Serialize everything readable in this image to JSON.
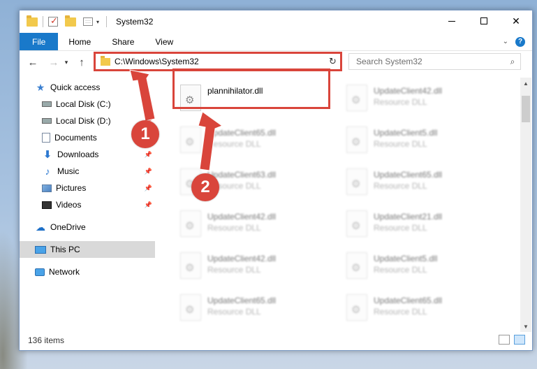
{
  "window": {
    "title": "System32"
  },
  "ribbon": {
    "tabs": [
      "File",
      "Home",
      "Share",
      "View"
    ]
  },
  "navbar": {
    "address": "C:\\Windows\\System32",
    "search_placeholder": "Search System32"
  },
  "sidebar": {
    "items": [
      {
        "label": "Quick access",
        "icon": "star-icon",
        "pinned": false
      },
      {
        "label": "Local Disk (C:)",
        "icon": "disk-icon",
        "pinned": true
      },
      {
        "label": "Local Disk (D:)",
        "icon": "disk-icon",
        "pinned": true
      },
      {
        "label": "Documents",
        "icon": "documents-icon",
        "pinned": true
      },
      {
        "label": "Downloads",
        "icon": "downloads-icon",
        "pinned": true
      },
      {
        "label": "Music",
        "icon": "music-icon",
        "pinned": true
      },
      {
        "label": "Pictures",
        "icon": "pictures-icon",
        "pinned": true
      },
      {
        "label": "Videos",
        "icon": "videos-icon",
        "pinned": true
      },
      {
        "label": "OneDrive",
        "icon": "cloud-icon",
        "pinned": false
      },
      {
        "label": "This PC",
        "icon": "computer-icon",
        "pinned": false,
        "selected": true
      },
      {
        "label": "Network",
        "icon": "network-icon",
        "pinned": false
      }
    ]
  },
  "files": [
    {
      "name": "plannihilator.dll",
      "desc": "",
      "highlight": true
    },
    {
      "name": "UpdateClient42.dll",
      "desc": "Resource DLL"
    },
    {
      "name": "UpdateClient65.dll",
      "desc": "Resource DLL"
    },
    {
      "name": "UpdateClient5.dll",
      "desc": "Resource DLL"
    },
    {
      "name": "UpdateClient63.dll",
      "desc": "Resource DLL"
    },
    {
      "name": "UpdateClient65.dll",
      "desc": "Resource DLL"
    },
    {
      "name": "UpdateClient42.dll",
      "desc": "Resource DLL"
    },
    {
      "name": "UpdateClient21.dll",
      "desc": "Resource DLL"
    },
    {
      "name": "UpdateClient42.dll",
      "desc": "Resource DLL"
    },
    {
      "name": "UpdateClient5.dll",
      "desc": "Resource DLL"
    },
    {
      "name": "UpdateClient65.dll",
      "desc": "Resource DLL"
    },
    {
      "name": "UpdateClient65.dll",
      "desc": "Resource DLL"
    }
  ],
  "status": {
    "items_count": "136 items"
  },
  "annotations": {
    "step1": "1",
    "step2": "2",
    "color": "#d9453b"
  },
  "colors": {
    "accent": "#1979ca",
    "highlight": "#d9453b"
  }
}
